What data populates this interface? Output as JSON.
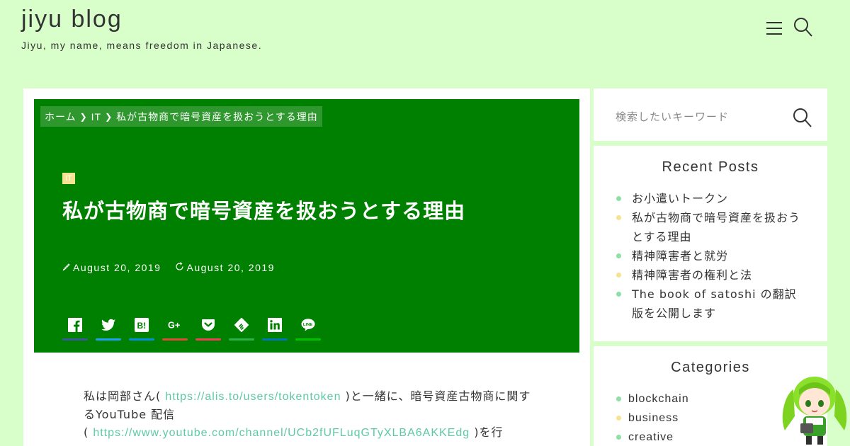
{
  "header": {
    "title": "jiyu blog",
    "description": "Jiyu, my name, means freedom in Japanese.",
    "menu_icon": "menu-icon",
    "search_icon": "search-icon"
  },
  "breadcrumb": {
    "home": "ホーム",
    "category": "IT",
    "current": "私が古物商で暗号資産を扱おうとする理由"
  },
  "post": {
    "category_badge": "IT",
    "title": "私が古物商で暗号資産を扱おうとする理由",
    "published": "August 20, 2019",
    "updated": "August 20, 2019",
    "body_1": "私は岡部さん( ",
    "link_1": "https://alis.to/users/tokentoken",
    "body_2": " )と一緒に、暗号資産古物商に関するYouTube 配信",
    "body_3": "( ",
    "link_2": "https://www.youtube.com/channel/UCb2fUFLuqGTyXLBA6AKKEdg",
    "body_4": " )を行"
  },
  "share_buttons": [
    {
      "icon": "facebook-icon",
      "color": "#3b5998"
    },
    {
      "icon": "twitter-icon",
      "color": "#1da1f2"
    },
    {
      "icon": "hatena-icon",
      "color": "#008fde"
    },
    {
      "icon": "googleplus-icon",
      "color": "#dd4b39"
    },
    {
      "icon": "pocket-icon",
      "color": "#ef4056"
    },
    {
      "icon": "feedly-icon",
      "color": "#2bb24c"
    },
    {
      "icon": "linkedin-icon",
      "color": "#0077b5"
    },
    {
      "icon": "line-icon",
      "color": "#00c300"
    }
  ],
  "sidebar": {
    "search_placeholder": "検索したいキーワード",
    "recent_title": "Recent Posts",
    "recent_posts": [
      "お小遣いトークン",
      "私が古物商で暗号資産を扱おうとする理由",
      "精神障害者と就労",
      "精神障害者の権利と法",
      "The book of satoshi の翻訳版を公開します"
    ],
    "categories_title": "Categories",
    "categories": [
      "blockchain",
      "business",
      "creative"
    ]
  },
  "colors": {
    "accent": "#008000",
    "background": "#d8ffca",
    "dot_green": "#8de0a6",
    "dot_yellow": "#f7e28f",
    "link": "#5cc9a7"
  }
}
